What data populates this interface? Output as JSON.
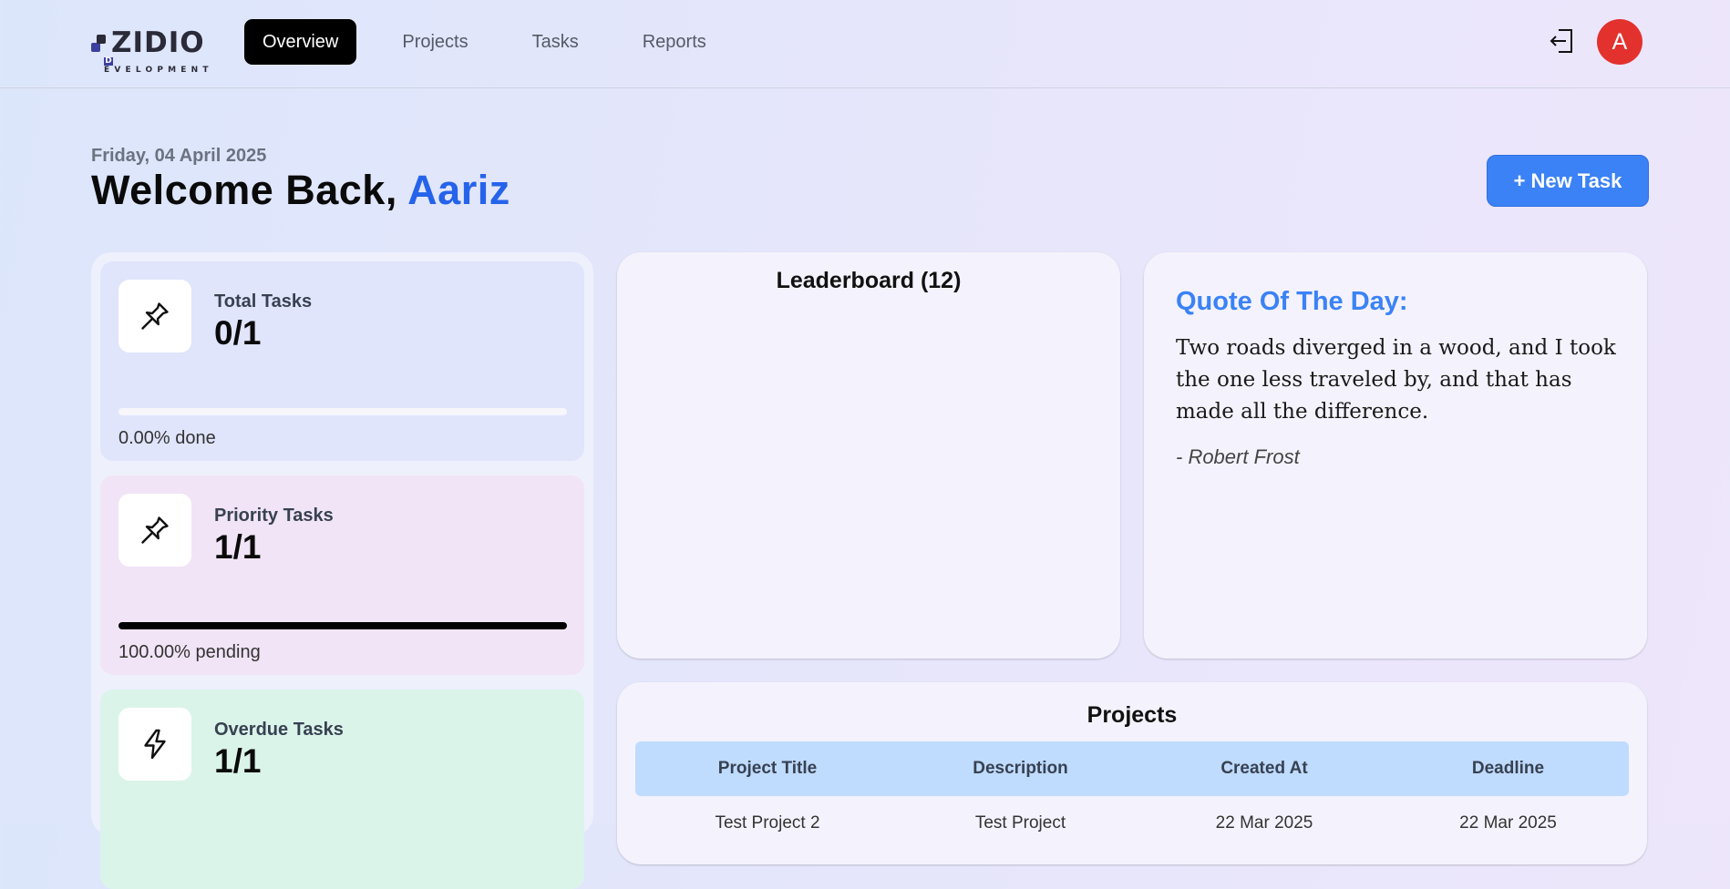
{
  "brand": {
    "word": "ZIDIO",
    "sub_initial": "D",
    "sub_rest": "EVELOPMENT"
  },
  "nav": {
    "items": [
      "Overview",
      "Projects",
      "Tasks",
      "Reports"
    ],
    "active": "Overview"
  },
  "user": {
    "avatar_initial": "A"
  },
  "header": {
    "date": "Friday, 04 April 2025",
    "welcome_prefix": "Welcome Back, ",
    "user_name": "Aariz"
  },
  "new_task_label": "+ New Task",
  "stats": [
    {
      "label": "Total Tasks",
      "value": "0/1",
      "caption": "0.00% done",
      "progress": 0,
      "icon": "pin-icon",
      "bg": "#e0e5fc"
    },
    {
      "label": "Priority Tasks",
      "value": "1/1",
      "caption": "100.00% pending",
      "progress": 100,
      "icon": "pin-icon",
      "bg": "#f1e4f6"
    },
    {
      "label": "Overdue Tasks",
      "value": "1/1",
      "caption": "",
      "progress": null,
      "icon": "bolt-icon",
      "bg": "#dbf4ea"
    }
  ],
  "leaderboard": {
    "title": "Leaderboard (12)"
  },
  "quote": {
    "title": "Quote Of The Day:",
    "text": "Two roads diverged in a wood, and I took the one less traveled by, and that has made all the difference.",
    "author": "- Robert Frost"
  },
  "projects": {
    "title": "Projects",
    "columns": [
      "Project Title",
      "Description",
      "Created At",
      "Deadline"
    ],
    "rows": [
      [
        "Test Project 2",
        "Test Project",
        "22 Mar 2025",
        "22 Mar 2025"
      ]
    ]
  },
  "colors": {
    "accent": "#3b82f6",
    "name": "#2563eb",
    "avatar": "#e3312e",
    "table_header": "#bfdbfe"
  }
}
